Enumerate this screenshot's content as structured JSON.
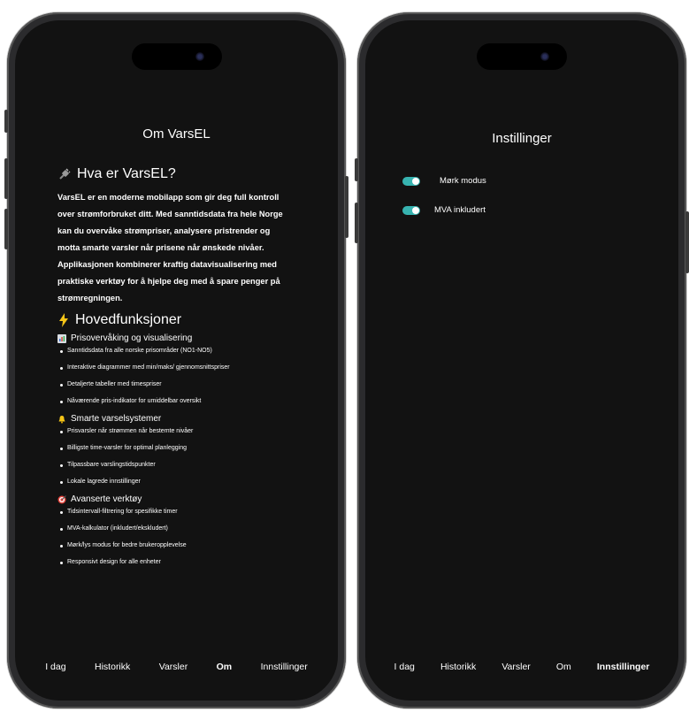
{
  "about": {
    "title": "Om VarsEL",
    "what_heading": "Hva er VarsEL?",
    "description": "VarsEL er en moderne mobilapp som gir deg full kontroll over strømforbruket ditt. Med sanntidsdata fra hele Norge kan du overvåke strømpriser, analysere pristrender og motta smarte varsler når prisene når ønskede nivåer. Applikasjonen kombinerer kraftig datavisualisering med praktiske verktøy for å hjelpe deg med å spare penger på strømregningen.",
    "features_heading": "Hovedfunksjoner",
    "sections": [
      {
        "icon": "bar-chart-icon",
        "title": "Prisovervåking og visualisering",
        "items": [
          "Sanntidsdata fra alle norske prisområder (NO1-NO5)",
          "Interaktive diagrammer med min/maks/ gjennomsnittspriser",
          "Detaljerte tabeller med timespriser",
          "Nåværende pris-indikator for umiddelbar oversikt"
        ]
      },
      {
        "icon": "bell-icon",
        "title": "Smarte varselsystemer",
        "items": [
          "Prisvarsler når strømmen når bestemte nivåer",
          "Billigste time-varsler for optimal planlegging",
          "Tilpassbare varslingstidspunkter",
          "Lokale lagrede innstillinger"
        ]
      },
      {
        "icon": "dart-icon",
        "title": "Avanserte verktøy",
        "items": [
          "Tidsintervall-filtrering for spesifikke timer",
          "MVA-kalkulator (inkludert/ekskludert)",
          "Mørk/lys modus for bedre brukeropplevelse",
          "Responsivt design for alle enheter"
        ]
      }
    ]
  },
  "settings": {
    "title": "Instillinger",
    "toggles": [
      {
        "label": "Mørk modus",
        "on": true
      },
      {
        "label": "MVA inkludert",
        "on": true
      }
    ]
  },
  "nav_left": {
    "items": [
      "I dag",
      "Historikk",
      "Varsler",
      "Om",
      "Innstillinger"
    ],
    "active": "Om"
  },
  "nav_right": {
    "items": [
      "I dag",
      "Historikk",
      "Varsler",
      "Om",
      "Innstillinger"
    ],
    "active": "Innstillinger"
  },
  "colors": {
    "screen_bg": "#121212",
    "toggle_accent": "#37b3b0",
    "text": "#ffffff"
  }
}
